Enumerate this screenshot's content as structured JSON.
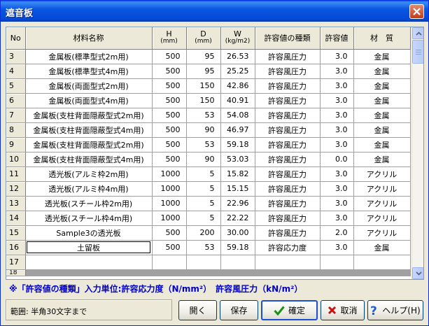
{
  "window": {
    "title": "遮音板"
  },
  "table": {
    "headers": {
      "no": "No",
      "name": "材料名称",
      "h": "H",
      "h_unit": "(mm)",
      "d": "D",
      "d_unit": "(mm)",
      "w": "W",
      "w_unit": "(kg/m2)",
      "type": "許容値の種類",
      "allow": "許容値",
      "mat": "材　質"
    },
    "rows": [
      {
        "no": "3",
        "name": "金属板(標準型式2m用)",
        "h": "500",
        "d": "95",
        "w": "26.53",
        "type": "許容風圧力",
        "allow": "3.0",
        "mat": "金属"
      },
      {
        "no": "4",
        "name": "金属板(標準型式4m用)",
        "h": "500",
        "d": "95",
        "w": "25.25",
        "type": "許容風圧力",
        "allow": "3.0",
        "mat": "金属"
      },
      {
        "no": "5",
        "name": "金属板(両面型式2m用)",
        "h": "500",
        "d": "150",
        "w": "42.86",
        "type": "許容風圧力",
        "allow": "3.0",
        "mat": "金属"
      },
      {
        "no": "6",
        "name": "金属板(両面型式4m用)",
        "h": "500",
        "d": "150",
        "w": "40.91",
        "type": "許容風圧力",
        "allow": "3.0",
        "mat": "金属"
      },
      {
        "no": "7",
        "name": "金属板(支柱背面隠蔽型式2m用)",
        "h": "500",
        "d": "53",
        "w": "54.08",
        "type": "許容風圧力",
        "allow": "3.0",
        "mat": "金属"
      },
      {
        "no": "8",
        "name": "金属板(支柱背面隠蔽型式4m用)",
        "h": "500",
        "d": "90",
        "w": "46.97",
        "type": "許容風圧力",
        "allow": "3.0",
        "mat": "金属"
      },
      {
        "no": "9",
        "name": "金属板(支柱背面隠蔽型式2m用)",
        "h": "500",
        "d": "53",
        "w": "59.18",
        "type": "許容風圧力",
        "allow": "3.0",
        "mat": "金属"
      },
      {
        "no": "10",
        "name": "金属板(支柱背面隠蔽型式4m用)",
        "h": "500",
        "d": "90",
        "w": "53.03",
        "type": "許容風圧力",
        "allow": "0.0",
        "mat": "金属"
      },
      {
        "no": "11",
        "name": "透光板(アルミ枠2m用)",
        "h": "1000",
        "d": "5",
        "w": "15.82",
        "type": "許容風圧力",
        "allow": "3.0",
        "mat": "アクリル"
      },
      {
        "no": "12",
        "name": "透光板(アルミ枠4m用)",
        "h": "1000",
        "d": "5",
        "w": "15.15",
        "type": "許容風圧力",
        "allow": "3.0",
        "mat": "アクリル"
      },
      {
        "no": "13",
        "name": "透光板(スチール枠2m用)",
        "h": "1000",
        "d": "5",
        "w": "22.96",
        "type": "許容風圧力",
        "allow": "3.0",
        "mat": "アクリル"
      },
      {
        "no": "14",
        "name": "透光板(スチール枠4m用)",
        "h": "1000",
        "d": "5",
        "w": "22.22",
        "type": "許容風圧力",
        "allow": "3.0",
        "mat": "アクリル"
      },
      {
        "no": "15",
        "name": "Sample3の透光板",
        "h": "500",
        "d": "200",
        "w": "30.00",
        "type": "許容風圧力",
        "allow": "2.0",
        "mat": "アクリル"
      },
      {
        "no": "16",
        "name": "土留板",
        "h": "500",
        "d": "53",
        "w": "59.18",
        "type": "許容応力度",
        "allow": "3.0",
        "mat": "金属"
      },
      {
        "no": "17",
        "name": "",
        "h": "",
        "d": "",
        "w": "",
        "type": "",
        "allow": "",
        "mat": ""
      }
    ],
    "partial_row_no": "18"
  },
  "note": "※「許容値の種類」入力単位:許容応力度（N/mm²）　許容風圧力（kN/m²）",
  "status": {
    "text": "範囲: 半角30文字まで"
  },
  "buttons": {
    "open": "開く",
    "save": "保存",
    "ok": "確定",
    "cancel": "取消",
    "help": "ヘルプ(H)"
  },
  "colors": {
    "title_bar": "#0a57e0",
    "note_text": "#0000cc",
    "ok_icon": "#1a8f1a",
    "cancel_icon": "#cc1010",
    "help_icon": "#1a5fd0"
  }
}
